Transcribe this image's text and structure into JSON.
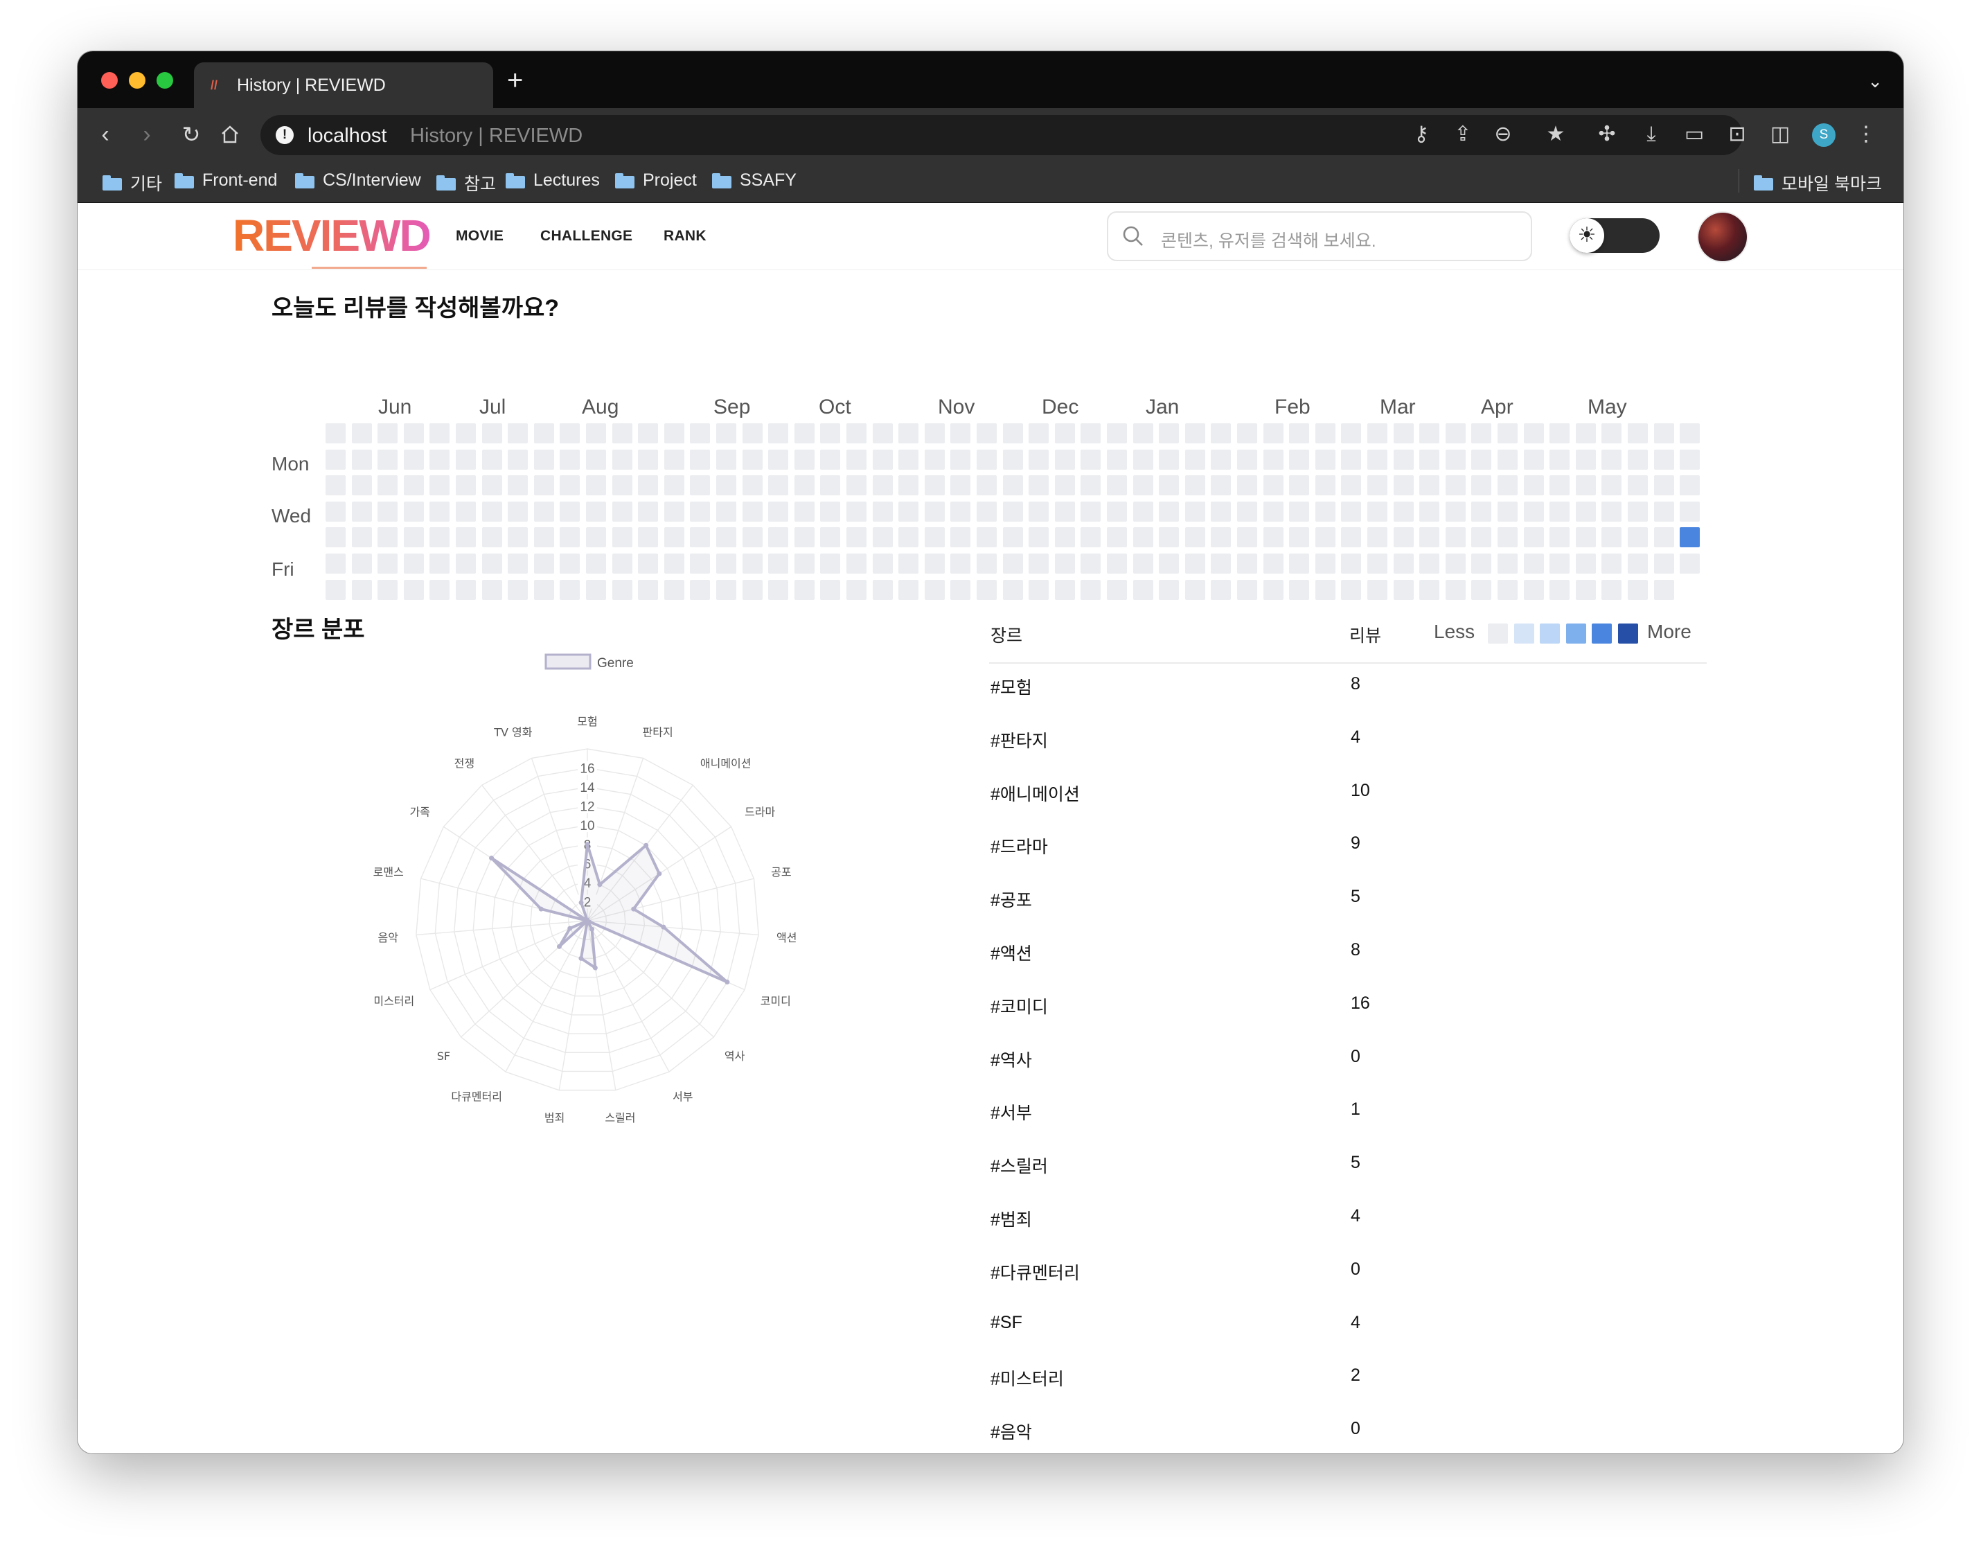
{
  "browser": {
    "tab_title": "History | REVIEWD",
    "url_host": "localhost",
    "url_title": "History | REVIEWD",
    "profile_initial": "S",
    "bookmarks": [
      "기타",
      "Front-end",
      "CS/Interview",
      "참고",
      "Lectures",
      "Project",
      "SSAFY"
    ],
    "mobile_bookmarks": "모바일 북마크"
  },
  "nav": {
    "logo": "REVIEWD",
    "menu": [
      "MOVIE",
      "CHALLENGE",
      "RANK"
    ],
    "search_placeholder": "콘텐츠, 유저를 검색해 보세요.",
    "theme_icon": "sun-icon"
  },
  "heatmap": {
    "title": "오늘도 리뷰를 작성해볼까요?",
    "months": [
      "Jun",
      "Jul",
      "Aug",
      "Sep",
      "Oct",
      "Nov",
      "Dec",
      "Jan",
      "Feb",
      "Mar",
      "Apr",
      "May"
    ],
    "weekdays": [
      "Mon",
      "Wed",
      "Fri"
    ],
    "weeks": 53,
    "last_week_days": 6,
    "active_cells": [
      {
        "week": 52,
        "day": 4,
        "level": 4
      }
    ],
    "legend_less": "Less",
    "legend_more": "More",
    "colors": [
      "#ebedf0",
      "#d6e4f7",
      "#bcd6f7",
      "#7fb0ee",
      "#4a86e0",
      "#2650a8"
    ]
  },
  "genre": {
    "title": "장르 분포",
    "table_headers": {
      "genre": "장르",
      "reviews": "리뷰"
    },
    "rows": [
      {
        "genre": "#모험",
        "count": "8"
      },
      {
        "genre": "#판타지",
        "count": "4"
      },
      {
        "genre": "#애니메이션",
        "count": "10"
      },
      {
        "genre": "#드라마",
        "count": "9"
      },
      {
        "genre": "#공포",
        "count": "5"
      },
      {
        "genre": "#액션",
        "count": "8"
      },
      {
        "genre": "#코미디",
        "count": "16"
      },
      {
        "genre": "#역사",
        "count": "0"
      },
      {
        "genre": "#서부",
        "count": "1"
      },
      {
        "genre": "#스릴러",
        "count": "5"
      },
      {
        "genre": "#범죄",
        "count": "4"
      },
      {
        "genre": "#다큐멘터리",
        "count": "0"
      },
      {
        "genre": "#SF",
        "count": "4"
      },
      {
        "genre": "#미스터리",
        "count": "2"
      },
      {
        "genre": "#음악",
        "count": "0"
      }
    ]
  },
  "chart_data": {
    "type": "radar",
    "legend": "Genre",
    "categories": [
      "모험",
      "판타지",
      "애니메이션",
      "드라마",
      "공포",
      "액션",
      "코미디",
      "역사",
      "서부",
      "스릴러",
      "범죄",
      "다큐멘터리",
      "SF",
      "미스터리",
      "음악",
      "로맨스",
      "가족",
      "전쟁",
      "TV 영화"
    ],
    "values": [
      8,
      4,
      10,
      9,
      5,
      8,
      16,
      0,
      1,
      5,
      4,
      0,
      4,
      2,
      0,
      5,
      12,
      0,
      2
    ],
    "r_ticks": [
      2,
      4,
      6,
      8,
      10,
      12,
      14,
      16
    ],
    "r_max": 18,
    "series_color": "#b3b1cc"
  }
}
